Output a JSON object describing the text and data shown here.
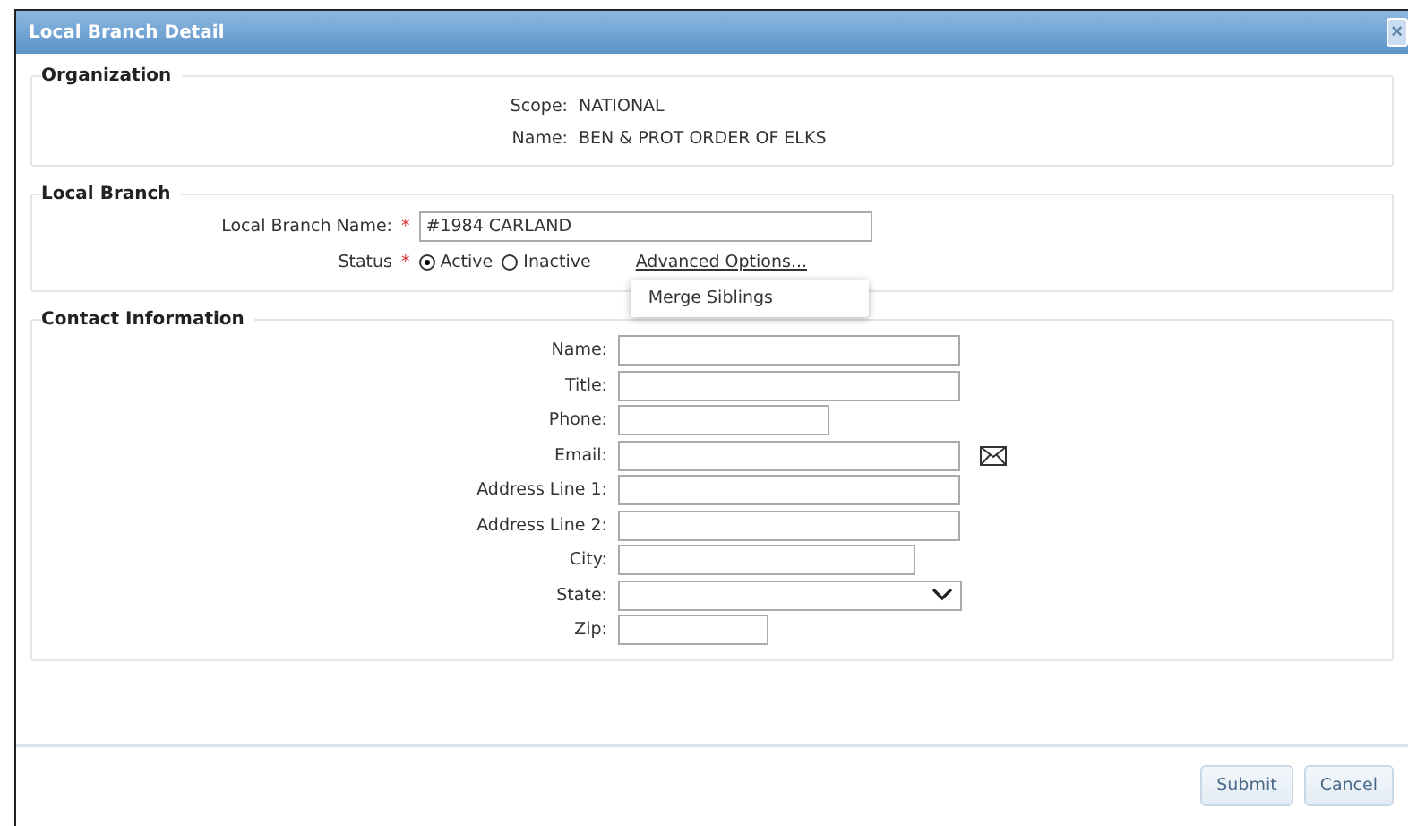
{
  "window": {
    "title": "Local Branch Detail",
    "close": "×"
  },
  "organization": {
    "legend": "Organization",
    "fields": [
      {
        "label": "Scope:",
        "value": "NATIONAL"
      },
      {
        "label": "Name:",
        "value": "BEN & PROT ORDER OF ELKS"
      }
    ]
  },
  "local_branch": {
    "legend": "Local Branch",
    "name_label": "Local Branch Name:",
    "required_mark": "*",
    "name_value": "#1984 CARLAND",
    "status_label": "Status",
    "status_required_mark": "*",
    "status_options": [
      {
        "label": "Active",
        "selected": true
      },
      {
        "label": "Inactive",
        "selected": false
      }
    ],
    "advanced_link": "Advanced Options...",
    "menu": {
      "items": [
        "Merge Siblings"
      ]
    }
  },
  "contact": {
    "legend": "Contact Information",
    "fields": [
      {
        "label": "Name:",
        "kind": "text"
      },
      {
        "label": "Title:",
        "kind": "text"
      },
      {
        "label": "Phone:",
        "kind": "short"
      },
      {
        "label": "Email:",
        "kind": "email"
      },
      {
        "label": "Address Line 1:",
        "kind": "text"
      },
      {
        "label": "Address Line 2:",
        "kind": "text"
      },
      {
        "label": "City:",
        "kind": "medium"
      },
      {
        "label": "State:",
        "kind": "select"
      },
      {
        "label": "Zip:",
        "kind": "tiny"
      }
    ]
  },
  "buttons": [
    "Submit",
    "Cancel"
  ]
}
